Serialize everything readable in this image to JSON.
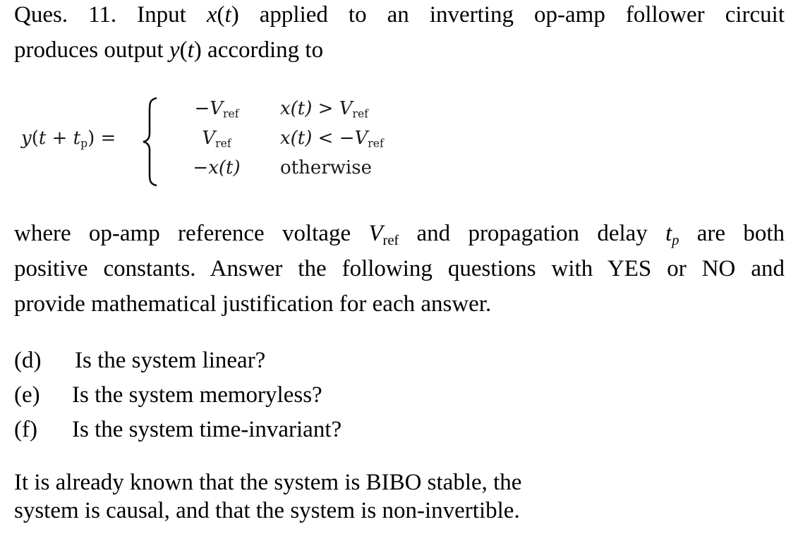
{
  "question": {
    "intro_line1": {
      "prefix": "Ques. 11. Input ",
      "x_var": "x",
      "x_arg": "(t)",
      "suffix": " applied to an inverting op-amp follower circuit"
    },
    "intro_line2": {
      "prefix": "produces output ",
      "y_var": "y",
      "y_arg": "(t)",
      "suffix": " according to"
    }
  },
  "equation": {
    "lhs": {
      "func": "y",
      "open": "(",
      "t": "t",
      "plus": " + ",
      "tp": "t",
      "tp_sub": "p",
      "close": ")",
      "equals": " = "
    },
    "cases": [
      {
        "value_main": "−V",
        "value_sub": "ref",
        "condition_main": "x(t) > V",
        "condition_sub": "ref"
      },
      {
        "value_main": "V",
        "value_sub": "ref",
        "condition_main": "x(t) < −V",
        "condition_sub": "ref"
      },
      {
        "value_main": "−x(t)",
        "value_sub": "",
        "condition_main": "otherwise",
        "condition_sub": ""
      }
    ]
  },
  "description": {
    "line1": {
      "a": "where op-amp reference voltage ",
      "v": "V",
      "v_sub": "ref",
      "b": " and propagation delay ",
      "t": "t",
      "t_sub": "p",
      "c": " are both"
    },
    "line2": "positive constants. Answer the following questions with YES or NO and",
    "line3": "provide mathematical justification for each answer."
  },
  "sub_questions": [
    {
      "label": "(d)",
      "text": "Is the system linear?"
    },
    {
      "label": "(e)",
      "text": "Is the system memoryless?"
    },
    {
      "label": "(f)",
      "text": "Is the system time-invariant?"
    }
  ],
  "note": {
    "line1": "It is already known that the system is BIBO stable, the",
    "line2": "system is causal, and that the system is non-invertible."
  }
}
